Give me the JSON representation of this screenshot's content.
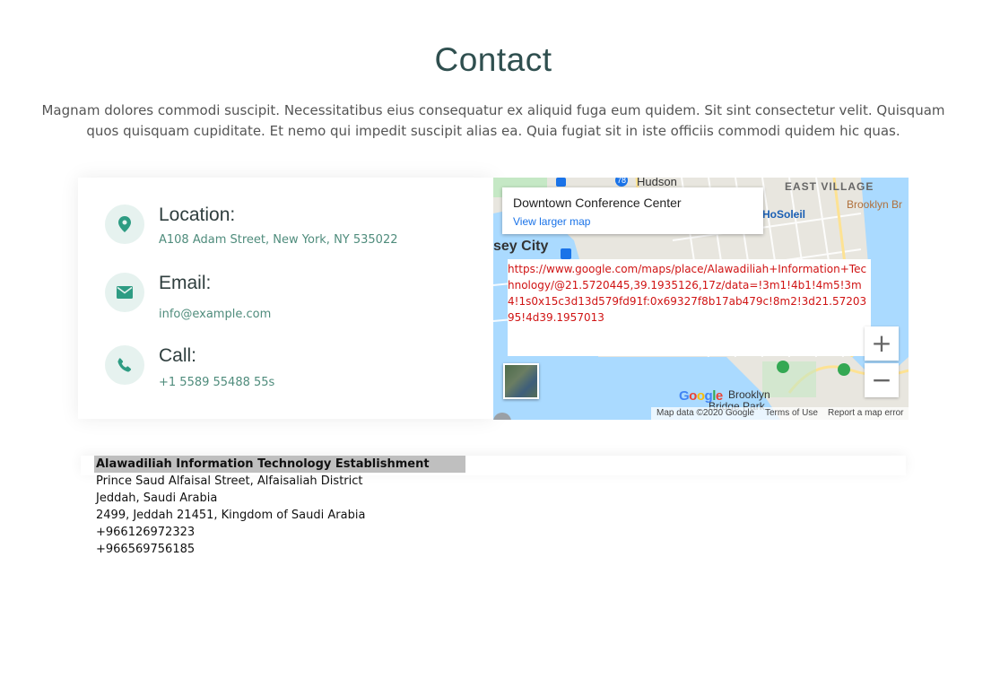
{
  "header": {
    "title": "Contact",
    "intro": "Magnam dolores commodi suscipit. Necessitatibus eius consequatur ex aliquid fuga eum quidem. Sit sint consectetur velit. Quisquam quos quisquam cupiditate. Et nemo qui impedit suscipit alias ea. Quia fugiat sit in iste officiis commodi quidem hic quas."
  },
  "info": [
    {
      "icon": "location-pin-icon",
      "label": "Location:",
      "value": "A108 Adam Street, New York, NY 535022"
    },
    {
      "icon": "envelope-icon",
      "label": "Email:",
      "value": "info@example.com"
    },
    {
      "icon": "phone-icon",
      "label": "Call:",
      "value": "+1 5589 55488 55s"
    }
  ],
  "map": {
    "place_name": "Downtown Conference Center",
    "view_larger": "View larger map",
    "broken_url": "https://www.google.com/maps/place/Alawadiliah+Information+Technology/@21.5720445,39.1935126,17z/data=!3m1!4b1!4m5!3m4!1s0x15c3d13d579fd91f:0x69327f8b17ab479c!8m2!3d21.5720395!4d39.1957013",
    "zoom_in": "+",
    "zoom_out": "−",
    "labels": {
      "hudson": "Hudson",
      "east_village": "EAST VILLAGE",
      "brooklyn": "Brooklyn Br",
      "hosoleil": "HoSoleil",
      "jersey_city": "sey City",
      "brooklyn_bridge_park": "Brooklyn",
      "bridge_park": "Bridge Park",
      "route_78": "78"
    },
    "google": "Google",
    "attribution": {
      "data": "Map data ©2020 Google",
      "terms": "Terms of Use",
      "report": "Report a map error"
    },
    "colors": {
      "water": "#aadaff",
      "land": "#e8e6df",
      "park": "#c5e8c5",
      "road": "#fde293"
    }
  },
  "address": {
    "company": "Alawadiliah Information Technology Establishment",
    "lines": [
      "Prince Saud Alfaisal Street, Alfaisaliah District",
      "Jeddah, Saudi Arabia",
      "2499, Jeddah 21451, Kingdom of Saudi Arabia",
      "+966126972323",
      "+966569756185"
    ]
  },
  "accent_color": "#2e9c83"
}
